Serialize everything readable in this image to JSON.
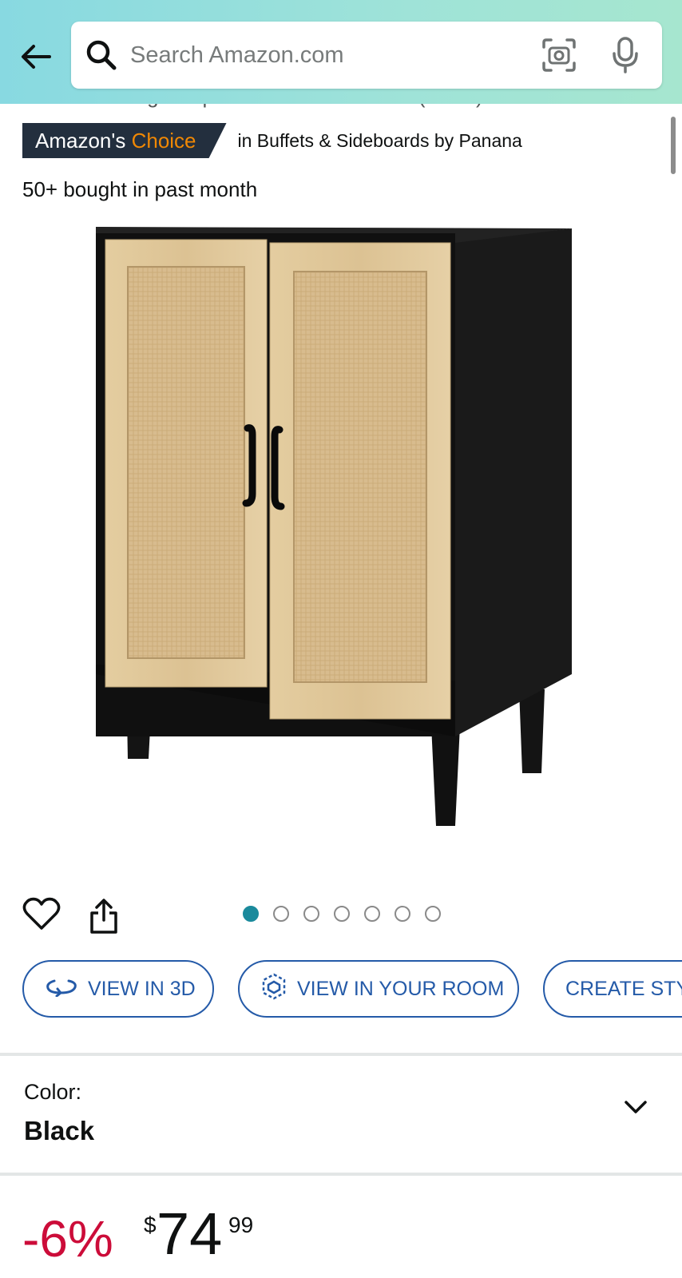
{
  "header": {
    "search_placeholder": "Search Amazon.com"
  },
  "product": {
    "title_partial": "Kitchen Storage Cupboard Accent Cabinet (Black)",
    "badge": {
      "prefix": "Amazon's",
      "accent": "Choice",
      "category_text": "in Buffets & Sideboards by Panana"
    },
    "social_proof": "50+ bought in past month",
    "image_count": 7,
    "active_image": 1
  },
  "actions": {
    "view_3d": "VIEW IN 3D",
    "view_room": "VIEW IN YOUR ROOM",
    "create_style": "CREATE STY"
  },
  "variant": {
    "label": "Color:",
    "value": "Black"
  },
  "price": {
    "discount": "-6%",
    "currency_symbol": "$",
    "whole": "74",
    "fraction": "99"
  },
  "colors": {
    "header_gradient_start": "#88d9e1",
    "header_gradient_end": "#a6e6cf",
    "badge_bg": "#232f3e",
    "badge_accent": "#f08804",
    "link_blue": "#245aa8",
    "discount_red": "#cc0c39",
    "dot_active": "#1a8a9c"
  },
  "icons": [
    "back-arrow-icon",
    "search-icon",
    "camera-icon",
    "microphone-icon",
    "heart-icon",
    "share-icon",
    "rotate-3d-icon",
    "ar-cube-icon",
    "chevron-down-icon"
  ]
}
